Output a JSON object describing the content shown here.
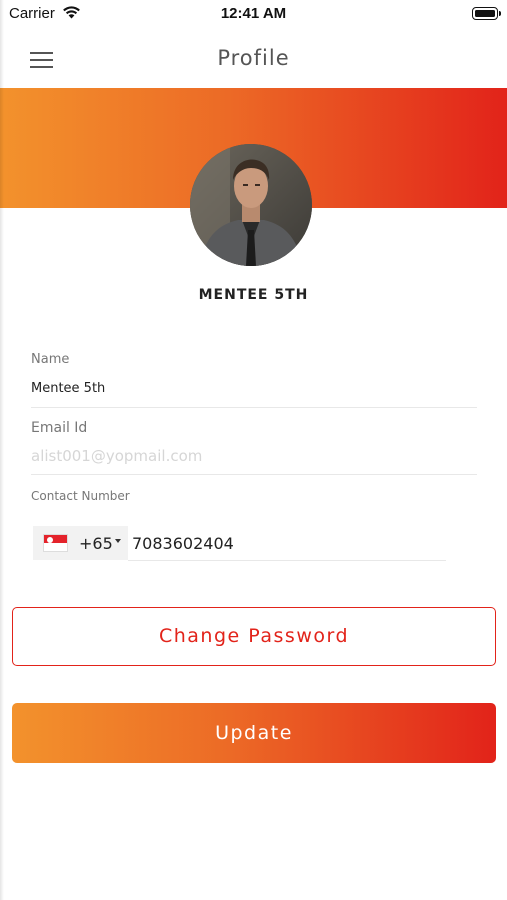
{
  "status_bar": {
    "carrier": "Carrier",
    "time": "12:41 AM",
    "wifi_icon": "wifi-icon",
    "battery_icon": "battery-icon"
  },
  "nav": {
    "title": "Profile",
    "menu_icon": "hamburger-menu-icon"
  },
  "profile": {
    "display_name": "MENTEE 5TH",
    "avatar": "user-avatar-photo"
  },
  "form": {
    "name_label": "Name",
    "name_value": "Mentee 5th",
    "email_label": "Email Id",
    "email_value": "alist001@yopmail.com",
    "contact_label": "Contact Number",
    "country_flag": "singapore-flag-icon",
    "dial_code": "+65",
    "phone_number": "7083602404"
  },
  "actions": {
    "change_password": "Change Password",
    "update": "Update"
  },
  "colors": {
    "gradient_start": "#f3922c",
    "gradient_end": "#e2231a",
    "accent": "#e2231a"
  }
}
